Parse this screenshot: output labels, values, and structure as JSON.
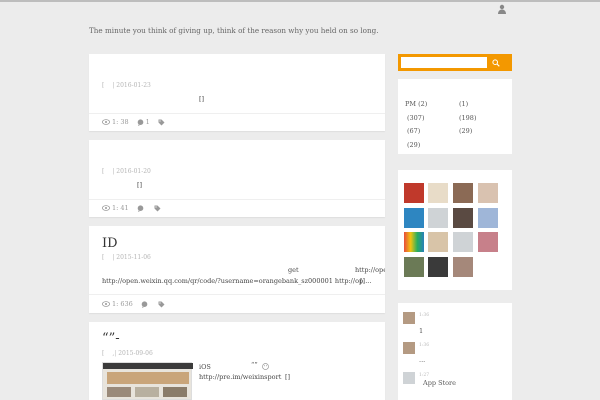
{
  "tagline": "The minute you think of giving up, think of the reason why you held on so long.",
  "posts": [
    {
      "meta_left": "[",
      "meta_date": "| 2016-01-23",
      "body": "[]",
      "views": "1: 38",
      "comments": "1"
    },
    {
      "meta_left": "[",
      "meta_date": "| 2016-01-20",
      "body": "[]",
      "views": "1: 41",
      "comments": ""
    },
    {
      "title": "ID",
      "meta_left": "[",
      "meta_date": "| 2015-11-06",
      "line1_a": "get",
      "line1_b": "http://ope",
      "line2": "http://open.weixin.qq.com/qr/code/?username=orangebank_sz000001 http://op....",
      "line2_end": "[]",
      "views": "1: 636"
    },
    {
      "title": "“”-",
      "meta_left": "[",
      "meta_mid": ",",
      "meta_date": "| 2015-09-06",
      "line1_a": "iOS",
      "line1_b": "“”",
      "line2": "http://pre.im/weixinsport",
      "line2_end": "[]"
    }
  ],
  "search": {
    "placeholder": ""
  },
  "archives": [
    {
      "left": "PM (2)",
      "right": "(1)"
    },
    {
      "left": "(307)",
      "right": "(198)"
    },
    {
      "left": "(67)",
      "right": "(29)"
    },
    {
      "left": "(29)",
      "right": ""
    }
  ],
  "recent_comments": [
    {
      "meta": "1:36",
      "text": "1"
    },
    {
      "meta": "1:36",
      "text": "..."
    },
    {
      "meta": "1:27",
      "text": "App Store"
    }
  ],
  "colors": {
    "accent": "#f39800",
    "background": "#ececec"
  },
  "icons": {
    "user": "user-icon",
    "views": "eye-icon",
    "comments": "comment-icon",
    "tags": "tag-icon",
    "search": "search-icon"
  }
}
